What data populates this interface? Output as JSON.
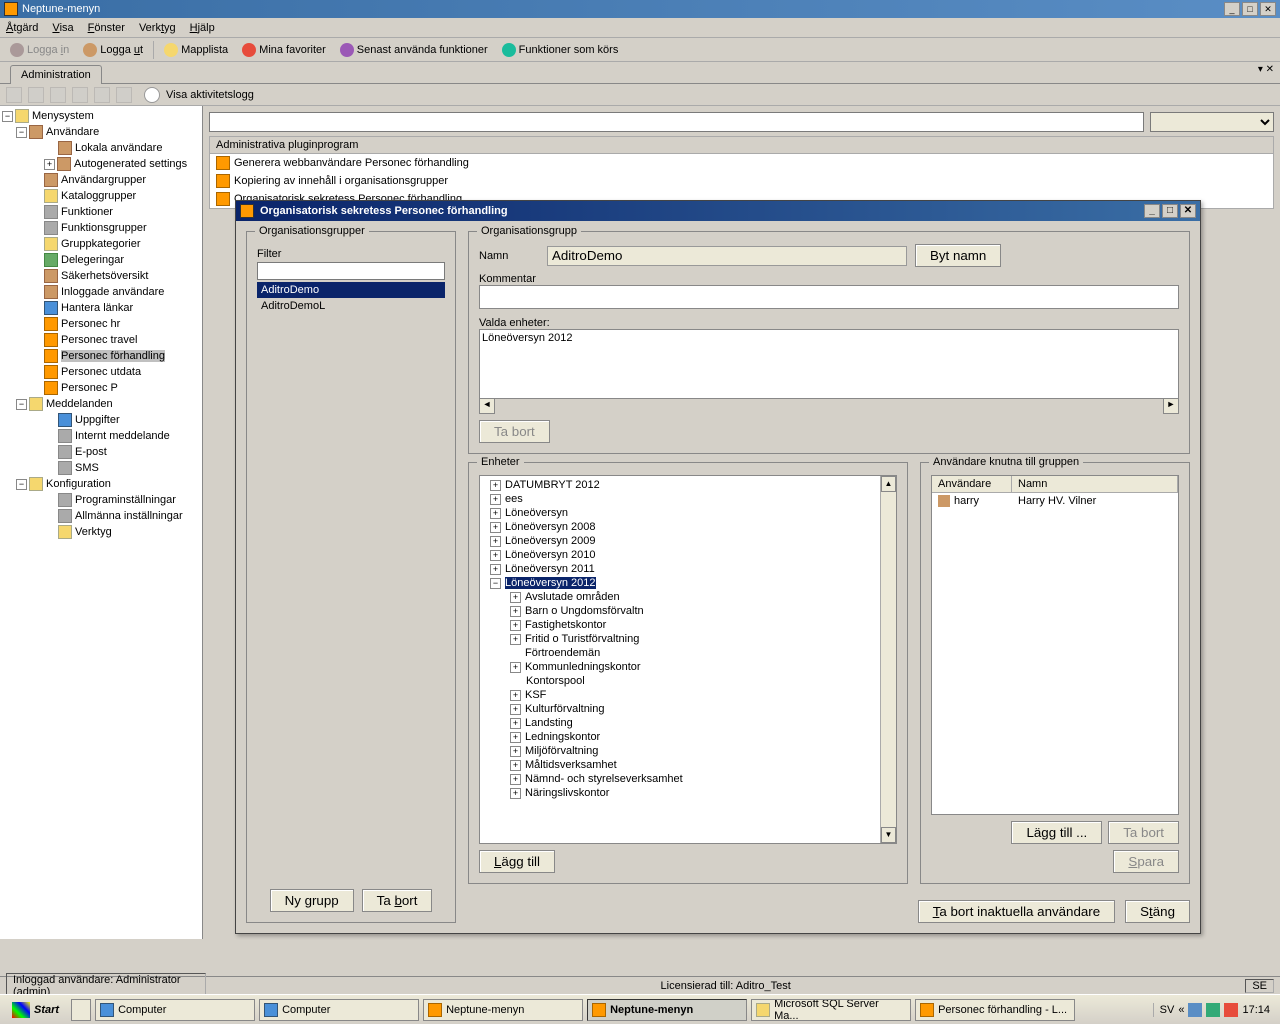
{
  "title": "Neptune-menyn",
  "menus": {
    "action": "Åtgärd",
    "view": "Visa",
    "window": "Fönster",
    "tools": "Verktyg",
    "help": "Hjälp"
  },
  "toolbar": {
    "login": "Logga in",
    "logout": "Logga ut",
    "folderlist": "Mapplista",
    "favorites": "Mina favoriter",
    "recent": "Senast använda funktioner",
    "running": "Funktioner som körs"
  },
  "tab": "Administration",
  "toolstrip": {
    "log": "Visa aktivitetslogg"
  },
  "tree": {
    "root": "Menysystem",
    "users": "Användare",
    "localUsers": "Lokala användare",
    "autogen": "Autogenerated settings",
    "userGroups": "Användargrupper",
    "catalogGroups": "Kataloggrupper",
    "functions": "Funktioner",
    "functionGroups": "Funktionsgrupper",
    "groupCategories": "Gruppkategorier",
    "delegations": "Delegeringar",
    "securityOverview": "Säkerhetsöversikt",
    "loggedUsers": "Inloggade användare",
    "manageLinks": "Hantera länkar",
    "personecHr": "Personec hr",
    "personecTravel": "Personec travel",
    "personecForhandling": "Personec förhandling",
    "personecUtdata": "Personec utdata",
    "personecP": "Personec P",
    "messages": "Meddelanden",
    "tasks": "Uppgifter",
    "internalMsg": "Internt meddelande",
    "email": "E-post",
    "sms": "SMS",
    "configuration": "Konfiguration",
    "programSettings": "Programinställningar",
    "generalSettings": "Allmänna inställningar",
    "tools": "Verktyg"
  },
  "plugins": {
    "header": "Administrativa pluginprogram",
    "items": [
      "Generera webbanvändare Personec förhandling",
      "Kopiering av innehåll i organisationsgrupper",
      "Organisatorisk sekretess Personec förhandling"
    ]
  },
  "dialog": {
    "title": "Organisatorisk sekretess Personec förhandling",
    "orgGroups": "Organisationsgrupper",
    "filter": "Filter",
    "orgItems": [
      "AditroDemo",
      "AditroDemoL"
    ],
    "newGroup": "Ny grupp",
    "delete": "Ta bort",
    "orgGroup": "Organisationsgrupp",
    "name": "Namn",
    "nameValue": "AditroDemo",
    "rename": "Byt namn",
    "comment": "Kommentar",
    "selectedUnits": "Valda enheter:",
    "selectedUnitItem": "Löneöversyn 2012",
    "remove": "Ta bort",
    "units": "Enheter",
    "unitTree": {
      "datum": "DATUMBRYT 2012",
      "ees": "ees",
      "loneo": "Löneöversyn",
      "l2008": "Löneöversyn 2008",
      "l2009": "Löneöversyn 2009",
      "l2010": "Löneöversyn 2010",
      "l2011": "Löneöversyn 2011",
      "l2012": "Löneöversyn 2012",
      "avslut": "Avslutade områden",
      "barn": "Barn o Ungdomsförvaltn",
      "fastig": "Fastighetskontor",
      "fritid": "Fritid o Turistförvaltning",
      "fortro": "Förtroendemän",
      "kommun": "Kommunledningskontor",
      "kontorspool": "Kontorspool",
      "ksf": "KSF",
      "kultur": "Kulturförvaltning",
      "landsting": "Landsting",
      "ledning": "Ledningskontor",
      "miljo": "Miljöförvaltning",
      "maltid": "Måltidsverksamhet",
      "namnd": "Nämnd- och styrelseverksamhet",
      "naring": "Näringslivskontor"
    },
    "add": "Lägg till",
    "usersInGroup": "Användare knutna till gruppen",
    "colUser": "Användare",
    "colName": "Namn",
    "userRow": {
      "user": "harry",
      "name": "Harry HV. Vilner"
    },
    "addDots": "Lägg till ...",
    "removeInactive": "Ta bort inaktuella användare",
    "close": "Stäng",
    "save": "Spara"
  },
  "status": {
    "loggedIn": "Inloggad användare: Administrator (admin)",
    "licensed": "Licensierad till: Aditro_Test",
    "lang": "SE"
  },
  "taskbar": {
    "start": "Start",
    "items": [
      "Computer",
      "Computer",
      "Neptune-menyn",
      "Neptune-menyn",
      "Microsoft SQL Server Ma...",
      "Personec förhandling - L..."
    ],
    "lang": "SV",
    "time": "17:14"
  }
}
